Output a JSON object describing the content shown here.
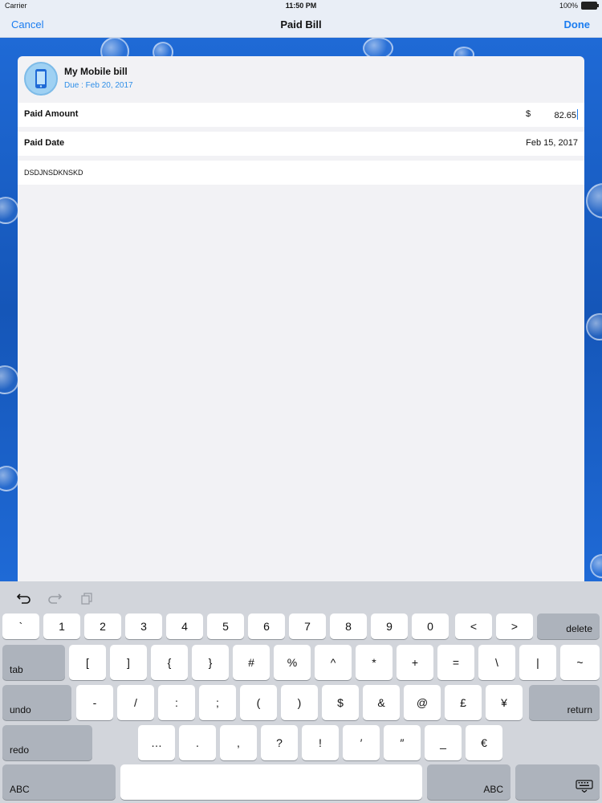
{
  "status_bar": {
    "carrier": "Carrier",
    "time": "11:50 PM",
    "battery": "100%"
  },
  "nav": {
    "cancel": "Cancel",
    "title": "Paid Bill",
    "done": "Done"
  },
  "bill": {
    "name": "My Mobile bill",
    "due": "Due : Feb 20, 2017",
    "icon": "mobile-phone-icon"
  },
  "paid_amount": {
    "label": "Paid Amount",
    "currency": "$",
    "value": "82.65"
  },
  "paid_date": {
    "label": "Paid Date",
    "value": "Feb 15, 2017"
  },
  "note": {
    "value": "DSDJNSDKNSKD"
  },
  "keyboard": {
    "toolbar": [
      "undo-arrow-icon",
      "redo-arrow-icon",
      "paste-icon"
    ],
    "row1": [
      "`",
      "1",
      "2",
      "3",
      "4",
      "5",
      "6",
      "7",
      "8",
      "9",
      "0",
      "<",
      ">",
      "delete"
    ],
    "row2": [
      "tab",
      "[",
      "]",
      "{",
      "}",
      "#",
      "%",
      "^",
      "*",
      "+",
      "=",
      "\\",
      "|",
      "~"
    ],
    "row3": [
      "undo",
      "-",
      "/",
      ":",
      ";",
      "(",
      ")",
      "$",
      "&",
      "@",
      "£",
      "¥",
      "return"
    ],
    "row4": [
      "redo",
      "…",
      ".",
      ",",
      "?",
      "!",
      "′",
      "″",
      "_",
      "€"
    ],
    "row5": [
      "ABC",
      "",
      "ABC"
    ],
    "dismiss_icon": "keyboard-dismiss-icon"
  },
  "colors": {
    "accent": "#1a7cf0",
    "due_text": "#2f8fe8",
    "background": "#1b5fc4"
  }
}
